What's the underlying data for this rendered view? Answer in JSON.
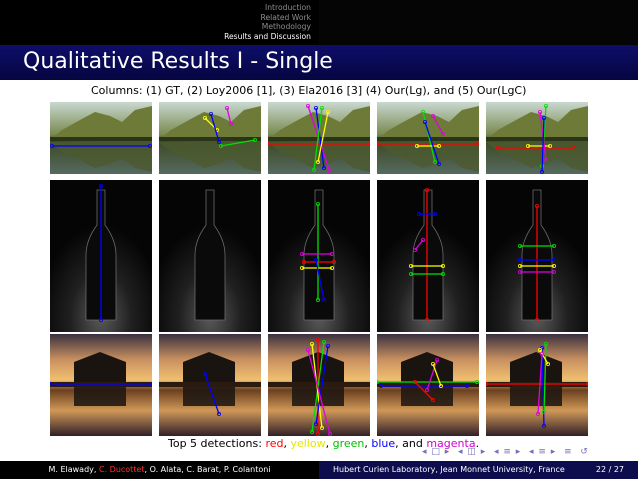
{
  "nav": {
    "items": [
      "Introduction",
      "Related Work",
      "Methodology",
      "Results and Discussion"
    ],
    "active": 3
  },
  "title": "Qualitative Results I - Single",
  "columns_caption": "Columns: (1) GT, (2) Loy2006 [1], (3) Ela2016 [3] (4) Our(Lg), and (5) Our(LgC)",
  "rows": [
    "lake",
    "bottle",
    "house"
  ],
  "methods": [
    "GT",
    "Loy2006",
    "Ela2016",
    "Our(Lg)",
    "Our(LgC)"
  ],
  "caption": {
    "prefix": "Top 5 detections: ",
    "red": "red",
    "sep1": ", ",
    "yellow": "yellow",
    "sep2": ", ",
    "green": "green",
    "sep3": ", ",
    "blue": "blue",
    "sep4": ", and ",
    "magenta": "magenta",
    "suffix": "."
  },
  "colors": {
    "red": "#ff0000",
    "yellow": "#ffff00",
    "green": "#00e000",
    "blue": "#0000ff",
    "magenta": "#e000e0",
    "title_bar": "#0e0e6a"
  },
  "footer": {
    "authors_a": "M. Elawady, ",
    "authors_hl": "C. Ducottet",
    "authors_b": ", O. Alata, C. Barat, P. Colantoni",
    "affiliation": "Hubert Curien Laboratory, Jean Monnet University, France",
    "page": "22 / 27"
  }
}
